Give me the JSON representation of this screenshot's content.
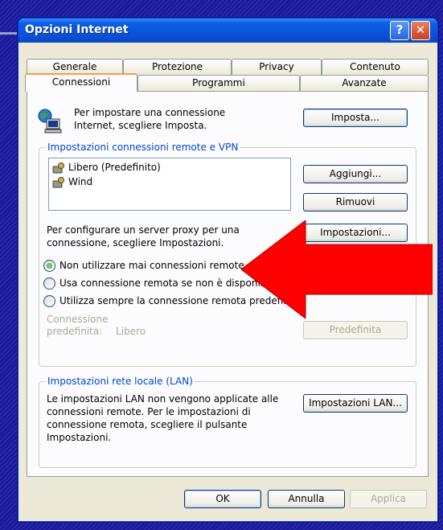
{
  "window": {
    "title": "Opzioni Internet",
    "help_label": "?",
    "close_label": "✕"
  },
  "tabs_row1": [
    "Generale",
    "Protezione",
    "Privacy",
    "Contenuto"
  ],
  "tabs_row2": [
    "Connessioni",
    "Programmi",
    "Avanzate"
  ],
  "setup": {
    "text_line1": "Per impostare una connessione",
    "text_line2": "Internet, scegliere Imposta.",
    "button": "Imposta..."
  },
  "dialup_group": {
    "title": "Impostazioni connessioni remote e VPN",
    "connections": [
      "Libero (Predefinito)",
      "Wind"
    ],
    "add_button": "Aggiungi...",
    "remove_button": "Rimuovi",
    "proxy_text_line1": "Per configurare un server proxy per una",
    "proxy_text_line2": "connessione, scegliere Impostazioni.",
    "settings_button": "Impostazioni...",
    "radio_options": [
      "Non utilizzare mai connessioni remote",
      "Usa connessione remota se non è disponibile",
      "Utilizza sempre la connessione remota predefinita"
    ],
    "selected_option": 0,
    "default_label_line1": "Connessione",
    "default_label_line2": "predefinita:",
    "default_value": "Libero",
    "default_button": "Predefinita"
  },
  "lan_group": {
    "title": "Impostazioni rete locale (LAN)",
    "text_line1": "Le impostazioni LAN non vengono applicate alle",
    "text_line2": "connessioni remote. Per le impostazioni di",
    "text_line3": "connessione remota, scegliere il pulsante",
    "text_line4": "Impostazioni.",
    "button": "Impostazioni LAN..."
  },
  "footer": {
    "ok": "OK",
    "cancel": "Annulla",
    "apply": "Applica"
  },
  "colors": {
    "arrow": "#ff0000",
    "title_blue": "#0a4fd0",
    "group_title": "#0046d5"
  }
}
